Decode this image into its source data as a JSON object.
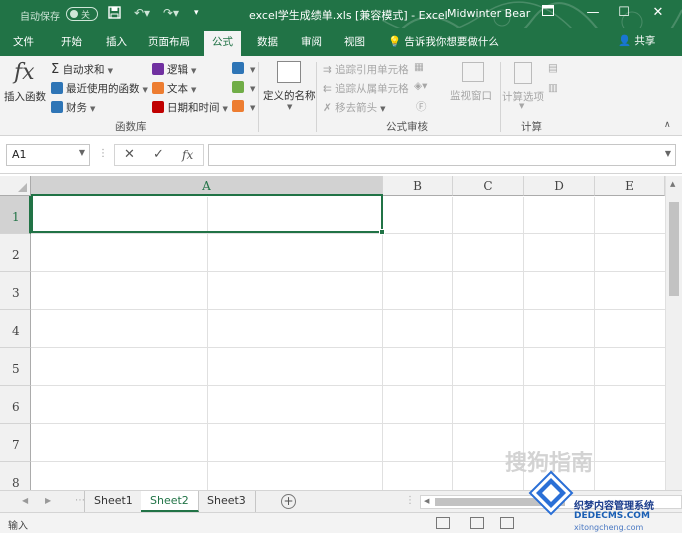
{
  "titlebar": {
    "autosave": "自动保存",
    "autosave_state": "关",
    "doc_title": "excel学生成绩单.xls  [兼容模式]  -  Excel",
    "user": "Midwinter Bear"
  },
  "tabs": [
    "文件",
    "开始",
    "插入",
    "页面布局",
    "公式",
    "数据",
    "审阅",
    "视图"
  ],
  "active_tab": "公式",
  "tell_me": "告诉我你想要做什么",
  "share": "共享",
  "ribbon": {
    "insert_function": "插入函数",
    "autosum": "自动求和",
    "recent": "最近使用的函数",
    "financial": "财务",
    "logical": "逻辑",
    "text": "文本",
    "datetime": "日期和时间",
    "define_name": "定义的名称",
    "trace_precedents": "追踪引用单元格",
    "trace_dependents": "追踪从属单元格",
    "remove_arrows": "移去箭头",
    "watch_window": "监视窗口",
    "calc_options": "计算选项",
    "group_function_library": "函数库",
    "group_formula_audit": "公式审核",
    "group_calc": "计算"
  },
  "formula_bar": {
    "name_box": "A1",
    "fx": "fx",
    "value": ""
  },
  "columns": [
    "A",
    "B",
    "C",
    "D",
    "E"
  ],
  "rows": [
    "1",
    "2",
    "3",
    "4",
    "5",
    "6",
    "7",
    "8"
  ],
  "sheets": [
    "Sheet1",
    "Sheet2",
    "Sheet3"
  ],
  "active_sheet": "Sheet2",
  "status": "输入",
  "watermark": {
    "text1": "搜狗指南",
    "text2": "织梦内容管理系统",
    "text3": "DEDECMS.COM",
    "text4": "xitongcheng.com"
  },
  "colors": {
    "brand": "#217346"
  }
}
